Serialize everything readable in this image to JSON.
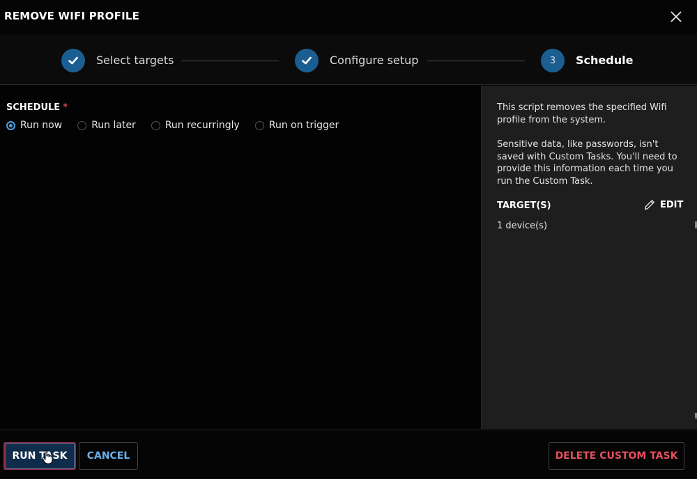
{
  "header": {
    "title": "REMOVE WIFI PROFILE"
  },
  "stepper": {
    "steps": [
      {
        "label": "Select targets",
        "status": "complete"
      },
      {
        "label": "Configure setup",
        "status": "complete"
      },
      {
        "number": "3",
        "label": "Schedule",
        "status": "active"
      }
    ]
  },
  "schedule": {
    "label": "SCHEDULE",
    "required_mark": "*",
    "options": [
      "Run now",
      "Run later",
      "Run recurringly",
      "Run on trigger"
    ],
    "selected": "Run now"
  },
  "sidebar": {
    "description": "This script removes the specified Wifi profile from the system.",
    "note": "Sensitive data, like passwords, isn't saved with Custom Tasks. You'll need to provide this information each time you run the Custom Task.",
    "targets_heading": "TARGET(S)",
    "edit_label": "EDIT",
    "targets_value": "1 device(s)"
  },
  "footer": {
    "run_label": "RUN TASK",
    "cancel_label": "CANCEL",
    "delete_label": "DELETE CUSTOM TASK"
  },
  "colors": {
    "accent": "#1b5f92",
    "radio_selected": "#4f9fe0",
    "link": "#6ab0ea",
    "danger": "#e4505f",
    "required": "#e0455a"
  },
  "icons": {
    "close": "close-icon",
    "step_complete": "check-icon",
    "edit": "pencil-icon",
    "cursor": "hand-pointer-icon"
  }
}
